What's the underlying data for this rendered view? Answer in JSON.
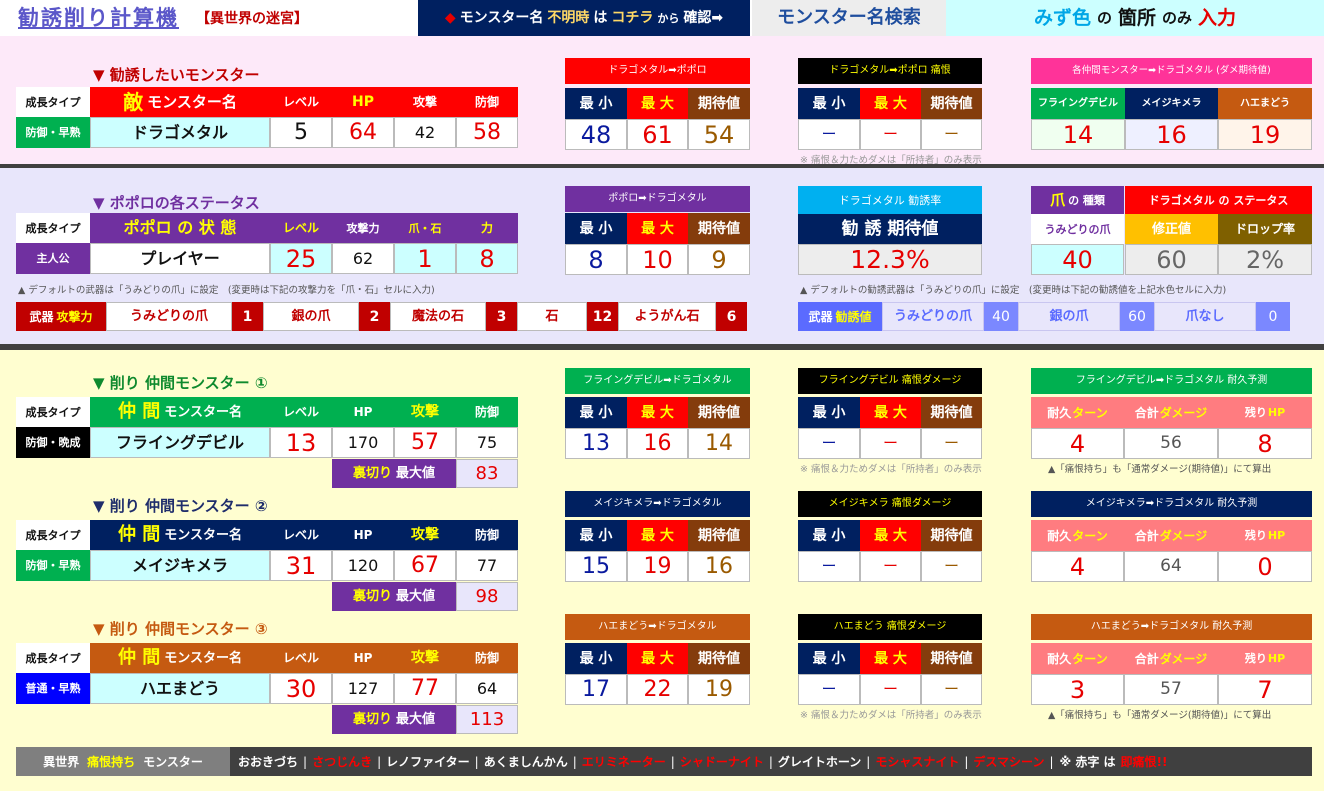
{
  "colors": {
    "navy": "#002060",
    "red": "#ff0000",
    "cyan": "#ccffff",
    "purple": "#7030a0",
    "green": "#00b050",
    "orange": "#c55a11",
    "brown": "#843c0c",
    "black": "#000000",
    "gray": "#595959",
    "pink": "#fde9f9",
    "lav": "#e8e6fb",
    "cream": "#fffed0"
  },
  "header": {
    "title": "勧誘削り計算機",
    "subtitle": "【異世界の迷宮】",
    "notice_diamond": "◆",
    "notice1": "モンスター名",
    "notice2": "不明時",
    "notice3": "は",
    "notice4": "コチラ",
    "notice5": "から",
    "notice6": "確認➡",
    "search_button": "モンスター名検索",
    "hint1": "みず色",
    "hint2": "の",
    "hint3": "箇所",
    "hint4": "のみ",
    "hint5": "入力"
  },
  "target": {
    "title": "▼ 勧誘したいモンスター",
    "growth_label": "成長タイプ",
    "growth_value": "防御・早熟",
    "name_label_a": "敵",
    "name_label_b": "モンスター名",
    "level_label": "レベル",
    "hp_label": "HP",
    "atk_label": "攻撃",
    "def_label": "防御",
    "name": "ドラゴメタル",
    "level": "5",
    "hp": "64",
    "atk": "42",
    "def": "58",
    "dmg_title": "ドラゴメタル➡ポポロ",
    "min_label": "最 小",
    "max_label": "最 大",
    "exp_label": "期待値",
    "dmg_min": "48",
    "dmg_max": "61",
    "dmg_exp": "54",
    "grudge_title": "ドラゴメタル➡ポポロ 痛恨",
    "grudge_min": "ー",
    "grudge_max": "ー",
    "grudge_exp": "ー",
    "grudge_note": "※ 痛恨＆力ためダメは「所持者」のみ表示",
    "ally_exp_title": "各仲間モンスター➡ドラゴメタル (ダメ期待値)",
    "ally1": "フライングデビル",
    "ally2": "メイジキメラ",
    "ally3": "ハエまどう",
    "ally1_val": "14",
    "ally2_val": "16",
    "ally3_val": "19"
  },
  "popolo": {
    "title": "▼ ポポロの各ステータス",
    "growth_label": "成長タイプ",
    "growth_value": "主人公",
    "state_label": "ポポロ の 状 態",
    "level_label": "レベル",
    "atk_label": "攻撃力",
    "claw_label": "爪・石",
    "power_label": "力",
    "name": "プレイヤー",
    "level": "25",
    "atk": "62",
    "claw": "1",
    "power": "8",
    "dmg_title": "ポポロ➡ドラゴメタル",
    "min_label": "最 小",
    "max_label": "最 大",
    "exp_label": "期待値",
    "dmg_min": "8",
    "dmg_max": "10",
    "dmg_exp": "9",
    "rate_title": "ドラゴメタル 勧誘率",
    "rate_label": "勧 誘 期待値",
    "rate_value": "12.3%",
    "claw_type_label_a": "爪",
    "claw_type_label_b": "の 種類",
    "status_label": "ドラゴメタル の ステータス",
    "claw_type": "うみどりの爪",
    "mod_label": "修正値",
    "drop_label": "ドロップ率",
    "mod_value": "40",
    "mod_value2": "60",
    "drop_value": "2%",
    "note_left": "▲ デフォルトの武器は「うみどりの爪」に設定　(変更時は下記の攻撃力を「爪・石」セルに入力)",
    "note_right": "▲ デフォルトの勧誘武器は「うみどりの爪」に設定　(変更時は下記の勧誘値を上記水色セルに入力)",
    "weapons_label_a": "武器",
    "weapons_label_b": "攻撃力",
    "weapons": [
      {
        "name": "うみどりの爪",
        "val": "1"
      },
      {
        "name": "銀の爪",
        "val": "2"
      },
      {
        "name": "魔法の石",
        "val": "3"
      },
      {
        "name": "石",
        "val": "12"
      },
      {
        "name": "ようがん石",
        "val": "6"
      }
    ],
    "lure_label_a": "武器",
    "lure_label_b": "勧誘値",
    "lure": [
      {
        "name": "うみどりの爪",
        "val": "40"
      },
      {
        "name": "銀の爪",
        "val": "60"
      },
      {
        "name": "爪なし",
        "val": "0"
      }
    ]
  },
  "allies": [
    {
      "title": "▼ 削り 仲間モンスター ①",
      "growth_label": "成長タイプ",
      "growth_value": "防御・晩成",
      "name_label_a": "仲 間",
      "name_label_b": "モンスター名",
      "level_label": "レベル",
      "hp_label": "HP",
      "atk_label": "攻撃",
      "def_label": "防御",
      "name": "フライングデビル",
      "level": "13",
      "hp": "170",
      "atk": "57",
      "def": "75",
      "betray_label_a": "裏切り",
      "betray_label_b": "最大値",
      "betray": "83",
      "dmg_title": "フライングデビル➡ドラゴメタル",
      "min_label": "最 小",
      "max_label": "最 大",
      "exp_label": "期待値",
      "dmg_min": "13",
      "dmg_max": "16",
      "dmg_exp": "14",
      "grudge_title": "フライングデビル 痛恨ダメージ",
      "grudge_min": "ー",
      "grudge_max": "ー",
      "grudge_exp": "ー",
      "grudge_note": "※ 痛恨＆力ためダメは「所持者」のみ表示",
      "endure_title": "フライングデビル➡ドラゴメタル 耐久予測",
      "turn_label_a": "耐久",
      "turn_label_b": "ターン",
      "total_label_a": "合計",
      "total_label_b": "ダメージ",
      "left_label_a": "残り",
      "left_label_b": "HP",
      "turn": "4",
      "total": "56",
      "left": "8",
      "endure_note": "▲「痛恨持ち」も「通常ダメージ(期待値)」にて算出"
    },
    {
      "title": "▼ 削り 仲間モンスター ②",
      "growth_label": "成長タイプ",
      "growth_value": "防御・早熟",
      "name_label_a": "仲 間",
      "name_label_b": "モンスター名",
      "level_label": "レベル",
      "hp_label": "HP",
      "atk_label": "攻撃",
      "def_label": "防御",
      "name": "メイジキメラ",
      "level": "31",
      "hp": "120",
      "atk": "67",
      "def": "77",
      "betray_label_a": "裏切り",
      "betray_label_b": "最大値",
      "betray": "98",
      "dmg_title": "メイジキメラ➡ドラゴメタル",
      "min_label": "最 小",
      "max_label": "最 大",
      "exp_label": "期待値",
      "dmg_min": "15",
      "dmg_max": "19",
      "dmg_exp": "16",
      "grudge_title": "メイジキメラ 痛恨ダメージ",
      "grudge_min": "ー",
      "grudge_max": "ー",
      "grudge_exp": "ー",
      "grudge_note": "",
      "endure_title": "メイジキメラ➡ドラゴメタル 耐久予測",
      "turn_label_a": "耐久",
      "turn_label_b": "ターン",
      "total_label_a": "合計",
      "total_label_b": "ダメージ",
      "left_label_a": "残り",
      "left_label_b": "HP",
      "turn": "4",
      "total": "64",
      "left": "0",
      "endure_note": ""
    },
    {
      "title": "▼ 削り 仲間モンスター ③",
      "growth_label": "成長タイプ",
      "growth_value": "普通・早熟",
      "name_label_a": "仲 間",
      "name_label_b": "モンスター名",
      "level_label": "レベル",
      "hp_label": "HP",
      "atk_label": "攻撃",
      "def_label": "防御",
      "name": "ハエまどう",
      "level": "30",
      "hp": "127",
      "atk": "77",
      "def": "64",
      "betray_label_a": "裏切り",
      "betray_label_b": "最大値",
      "betray": "113",
      "dmg_title": "ハエまどう➡ドラゴメタル",
      "min_label": "最 小",
      "max_label": "最 大",
      "exp_label": "期待値",
      "dmg_min": "17",
      "dmg_max": "22",
      "dmg_exp": "19",
      "grudge_title": "ハエまどう 痛恨ダメージ",
      "grudge_min": "ー",
      "grudge_max": "ー",
      "grudge_exp": "ー",
      "grudge_note": "※ 痛恨＆力ためダメは「所持者」のみ表示",
      "endure_title": "ハエまどう➡ドラゴメタル 耐久予測",
      "turn_label_a": "耐久",
      "turn_label_b": "ターン",
      "total_label_a": "合計",
      "total_label_b": "ダメージ",
      "left_label_a": "残り",
      "left_label_b": "HP",
      "turn": "3",
      "total": "57",
      "left": "7",
      "endure_note": "▲「痛恨持ち」も「通常ダメージ(期待値)」にて算出"
    }
  ],
  "footer": {
    "label_a": "異世界",
    "label_b": "痛恨持ち",
    "label_c": "モンスター",
    "monsters": [
      {
        "name": "おおきづち",
        "red": false
      },
      {
        "name": "さつじんき",
        "red": true
      },
      {
        "name": "レノファイター",
        "red": false
      },
      {
        "name": "あくましんかん",
        "red": false
      },
      {
        "name": "エリミネーター",
        "red": true
      },
      {
        "name": "シャドーナイト",
        "red": true
      },
      {
        "name": "グレイトホーン",
        "red": false
      },
      {
        "name": "モシャスナイト",
        "red": true
      },
      {
        "name": "デスマシーン",
        "red": true
      }
    ],
    "note_a": "※ 赤字 は",
    "note_b": "即痛恨!!"
  }
}
